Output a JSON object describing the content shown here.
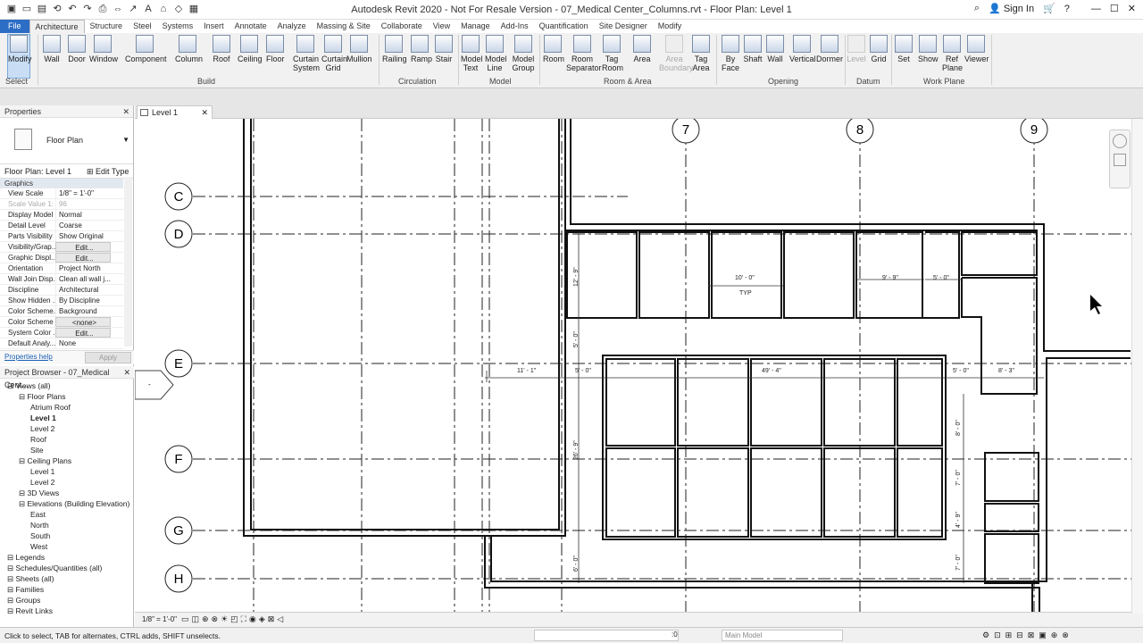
{
  "window": {
    "title": "Autodesk Revit 2020 - Not For Resale Version - 07_Medical Center_Columns.rvt - Floor Plan: Level 1",
    "sign_in": "Sign In"
  },
  "tabs": [
    "File",
    "Architecture",
    "Structure",
    "Steel",
    "Systems",
    "Insert",
    "Annotate",
    "Analyze",
    "Massing & Site",
    "Collaborate",
    "View",
    "Manage",
    "Add-Ins",
    "Quantification",
    "Site Designer",
    "Modify"
  ],
  "ribbon": {
    "buttons": [
      "Modify",
      "Wall",
      "Door",
      "Window",
      "Component",
      "Column",
      "Roof",
      "Ceiling",
      "Floor",
      "Curtain System",
      "Curtain Grid",
      "Mullion",
      "Railing",
      "Ramp",
      "Stair",
      "Model Text",
      "Model Line",
      "Model Group",
      "Room",
      "Room Separator",
      "Tag Room",
      "Area",
      "Area Boundary",
      "Tag Area",
      "By Face",
      "Shaft",
      "Wall",
      "Vertical",
      "Dormer",
      "Level",
      "Grid",
      "Set",
      "Show",
      "Ref Plane",
      "Viewer"
    ],
    "panels": [
      "Select",
      "Build",
      "Circulation",
      "Model",
      "Room & Area",
      "Opening",
      "Datum",
      "Work Plane"
    ]
  },
  "properties": {
    "header": "Properties",
    "type": "Floor Plan",
    "selector": "Floor Plan: Level 1",
    "edit_type": "Edit Type",
    "group": "Graphics",
    "rows": [
      {
        "k": "View Scale",
        "v": "1/8\" = 1'-0\""
      },
      {
        "k": "Scale Value 1:",
        "v": "96"
      },
      {
        "k": "Display Model",
        "v": "Normal"
      },
      {
        "k": "Detail Level",
        "v": "Coarse"
      },
      {
        "k": "Parts Visibility",
        "v": "Show Original"
      },
      {
        "k": "Visibility/Grap...",
        "v": "Edit..."
      },
      {
        "k": "Graphic Displ...",
        "v": "Edit..."
      },
      {
        "k": "Orientation",
        "v": "Project North"
      },
      {
        "k": "Wall Join Disp...",
        "v": "Clean all wall j..."
      },
      {
        "k": "Discipline",
        "v": "Architectural"
      },
      {
        "k": "Show Hidden ...",
        "v": "By Discipline"
      },
      {
        "k": "Color Scheme...",
        "v": "Background"
      },
      {
        "k": "Color Scheme",
        "v": "<none>"
      },
      {
        "k": "System Color ...",
        "v": "Edit..."
      },
      {
        "k": "Default Analy...",
        "v": "None"
      }
    ],
    "help": "Properties help",
    "apply": "Apply"
  },
  "browser": {
    "header": "Project Browser - 07_Medical Cent...",
    "items": [
      "Views (all)",
      "Floor Plans",
      "Atrium Roof",
      "Level 1",
      "Level 2",
      "Roof",
      "Site",
      "Ceiling Plans",
      "Level 1",
      "Level 2",
      "3D Views",
      "Elevations (Building Elevation)",
      "East",
      "North",
      "South",
      "West",
      "Legends",
      "Schedules/Quantities (all)",
      "Sheets (all)",
      "Families",
      "Groups",
      "Revit Links"
    ]
  },
  "view": {
    "tab": "Level 1",
    "scale": "1/8\" = 1'-0\""
  },
  "grids": {
    "cols": [
      "7",
      "8",
      "9"
    ],
    "rows": [
      "C",
      "D",
      "E",
      "F",
      "G",
      "H"
    ]
  },
  "dims": {
    "d1": "10' - 0\"",
    "d2": "TYP",
    "d3": "9' - 9\"",
    "d4": "5' - 0\"",
    "d5": "12' - 9\"",
    "d6": "5' - 0\"",
    "d7": "11' - 1\"",
    "d8": "5' - 0\"",
    "d9": "49' - 4\"",
    "d10": "5' - 0\"",
    "d11": "8' - 3\"",
    "d12": "26' - 9\"",
    "d13": "8' - 0\"",
    "d14": "7' - 0\"",
    "d15": "4' - 9\"",
    "d16": "7' - 0\"",
    "d17": "6' - 0\""
  },
  "status": {
    "message": "Click to select, TAB for alternates, CTRL adds, SHIFT unselects.",
    "workset_value": ":0",
    "model": "Main Model"
  }
}
